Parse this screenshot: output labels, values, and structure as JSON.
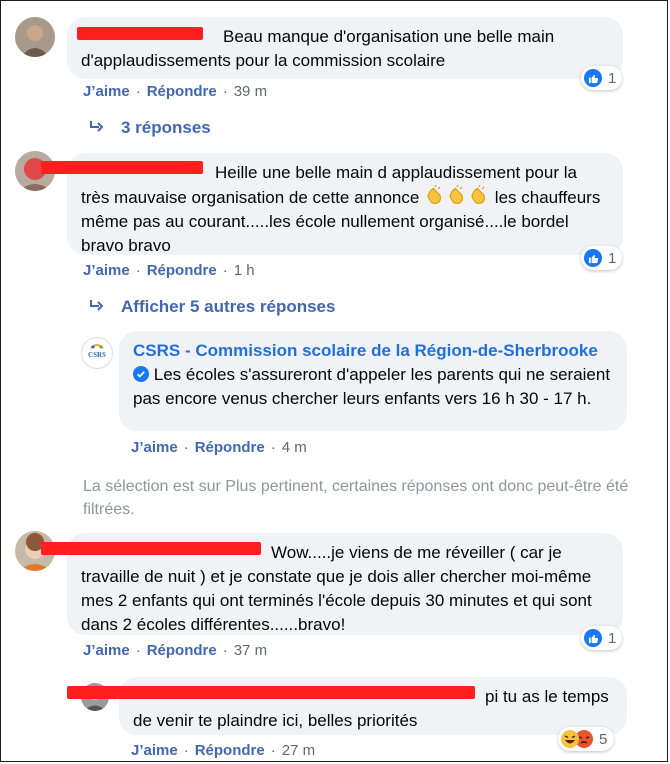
{
  "comments": [
    {
      "text": "Beau manque d'organisation une belle main d'applaudissements pour la commission scolaire",
      "actions": {
        "like": "J’aime",
        "reply": "Répondre",
        "time": "39 m"
      },
      "reaction_count": "1",
      "replies_link": "3 réponses"
    },
    {
      "text_before": "Heille une belle main d applaudissement pour la très mauvaise organisation de cette annonce",
      "emoji_name": "clapping-hands",
      "text_after": "les chauffeurs même pas au courant.....les école nullement organisé....le bordel bravo bravo",
      "actions": {
        "like": "J’aime",
        "reply": "Répondre",
        "time": "1 h"
      },
      "reaction_count": "1",
      "replies_link": "Afficher 5 autres réponses"
    },
    {
      "author": "CSRS - Commission scolaire de la Région-de-Sherbrooke",
      "avatar_text": "CSRS",
      "verified": true,
      "text": "Les écoles s'assureront d'appeler les parents qui ne seraient pas encore venus chercher leurs enfants vers 16 h 30 - 17 h.",
      "actions": {
        "like": "J’aime",
        "reply": "Répondre",
        "time": "4 m"
      }
    },
    {
      "text": "Wow.....je viens de me réveiller ( car je travaille de nuit ) et je constate que je dois aller chercher moi-même mes 2 enfants qui ont terminés l'école depuis 30 minutes et qui sont dans 2 écoles différentes......bravo!",
      "actions": {
        "like": "J’aime",
        "reply": "Répondre",
        "time": "37 m"
      },
      "reaction_count": "1"
    },
    {
      "text": "pi tu as le temps de venir te plaindre ici, belles priorités",
      "actions": {
        "like": "J’aime",
        "reply": "Répondre",
        "time": "27 m"
      },
      "reaction_count": "5",
      "reaction_icons": [
        "haha-icon",
        "angry-icon"
      ]
    }
  ],
  "filter_note": "La sélection est sur Plus pertinent, certaines réponses ont donc peut-être été filtrées.",
  "colors": {
    "link": "#4267b2",
    "bubble": "#f0f2f5",
    "like_blue": "#1877f2",
    "muted": "#65676b",
    "redaction": "#ff1f1f"
  }
}
